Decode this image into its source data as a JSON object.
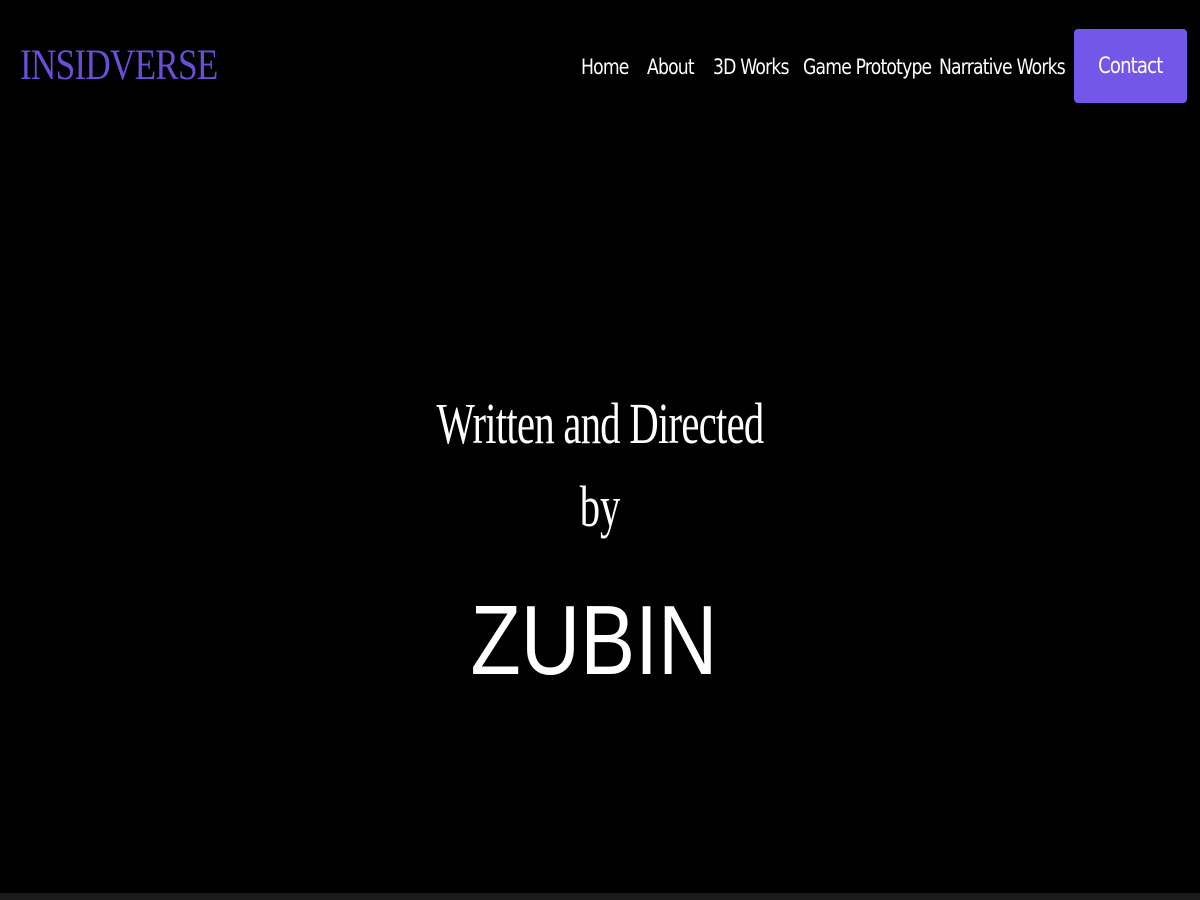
{
  "header": {
    "logo": "INSIDVERSE",
    "nav": {
      "home": "Home",
      "about": "About",
      "works_3d": "3D Works",
      "game_prototype": "Game Prototype",
      "narrative_works": "Narrative Works",
      "contact": "Contact"
    }
  },
  "hero": {
    "line1": "Written and Directed",
    "line2": "by",
    "name": "ZUBIN"
  },
  "colors": {
    "background": "#000000",
    "accent": "#7257e8",
    "logo": "#6a4dd8",
    "text": "#ffffff"
  }
}
